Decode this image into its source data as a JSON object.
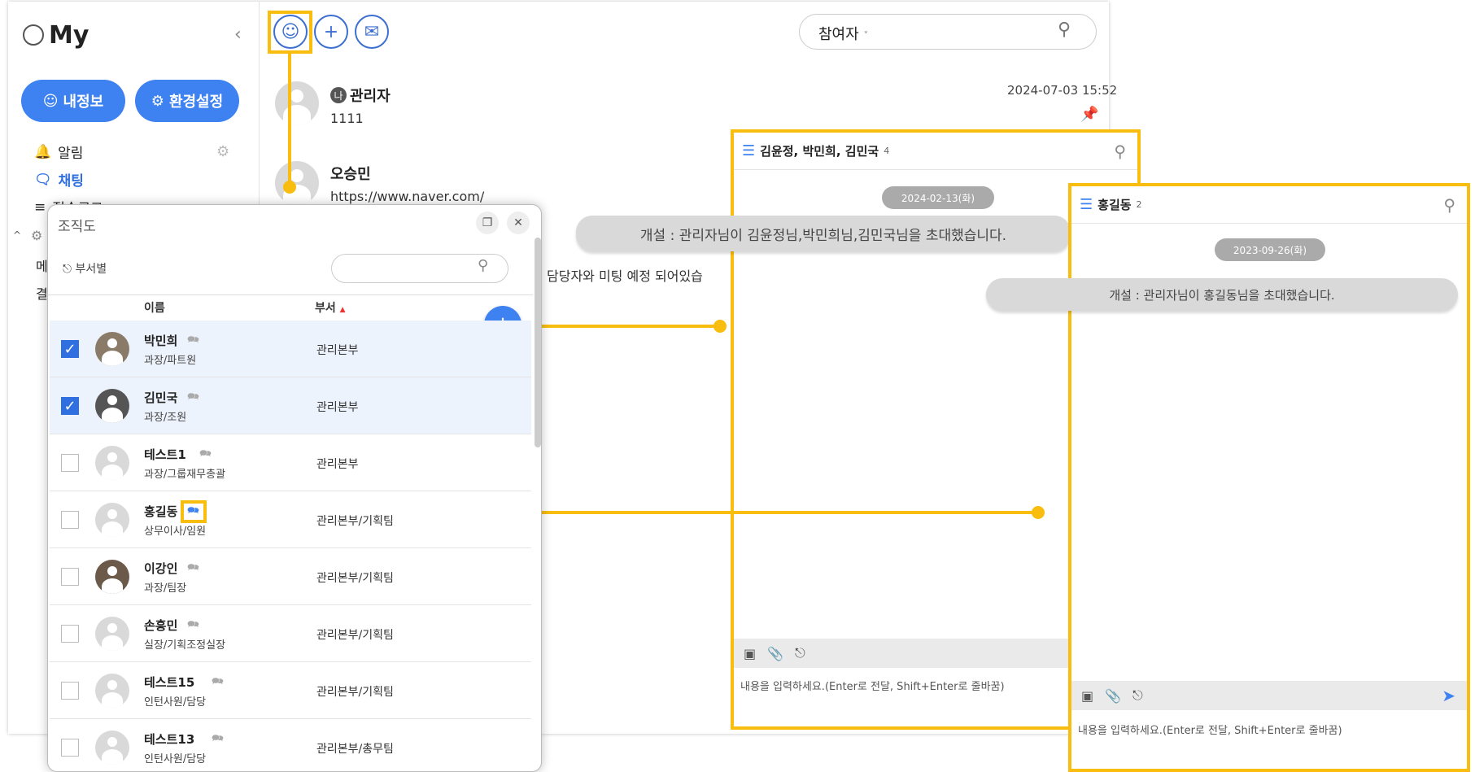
{
  "sidebar": {
    "title": "My",
    "buttons": {
      "profile": "내정보",
      "settings": "환경설정"
    },
    "menu": {
      "alarm": "알림",
      "chat": "채팅",
      "item3": "접속로그",
      "item4": "메",
      "item5": "결"
    }
  },
  "toolbar": {
    "filter_label": "참여자"
  },
  "messages": [
    {
      "badge": "나",
      "name": "관리자",
      "text": "1111",
      "time": "2024-07-03 15:52"
    },
    {
      "name": "오승민",
      "text": "https://www.naver.com/",
      "extra": "담당자와 미팅 예정 되어있습"
    }
  ],
  "org": {
    "title": "조직도",
    "dept_filter": "부서별",
    "col_name": "이름",
    "col_dept": "부서",
    "rows": [
      {
        "name": "박민희",
        "pos": "과장/파트원",
        "dept": "관리본부",
        "checked": true
      },
      {
        "name": "김민국",
        "pos": "과장/조원",
        "dept": "관리본부",
        "checked": true
      },
      {
        "name": "테스트1",
        "pos": "과장/그룹재무총괄",
        "dept": "관리본부",
        "checked": false
      },
      {
        "name": "홍길동",
        "pos": "상무이사/임원",
        "dept": "관리본부/기획팀",
        "checked": false
      },
      {
        "name": "이강인",
        "pos": "과장/팀장",
        "dept": "관리본부/기획팀",
        "checked": false
      },
      {
        "name": "손흥민",
        "pos": "실장/기획조정실장",
        "dept": "관리본부/기획팀",
        "checked": false
      },
      {
        "name": "테스트15",
        "pos": "인턴사원/담당",
        "dept": "관리본부/기획팀",
        "checked": false
      },
      {
        "name": "테스트13",
        "pos": "인턴사원/담당",
        "dept": "관리본부/총무팀",
        "checked": false
      }
    ]
  },
  "chat_group": {
    "title": "김윤정, 박민희, 김민국",
    "count": "4",
    "date": "2024-02-13(화)",
    "system": "개설 : 관리자님이 김윤정님,박민희님,김민국님을 초대했습니다.",
    "placeholder": "내용을 입력하세요.(Enter로 전달, Shift+Enter로 줄바꿈)"
  },
  "chat_single": {
    "title": "홍길동",
    "count": "2",
    "date": "2023-09-26(화)",
    "system": "개설 : 관리자님이 홍길동님을 초대했습니다.",
    "placeholder": "내용을 입력하세요.(Enter로 전달, Shift+Enter로 줄바꿈)"
  },
  "colors": {
    "highlight": "#f8bd0f",
    "primary": "#3d82f0"
  }
}
